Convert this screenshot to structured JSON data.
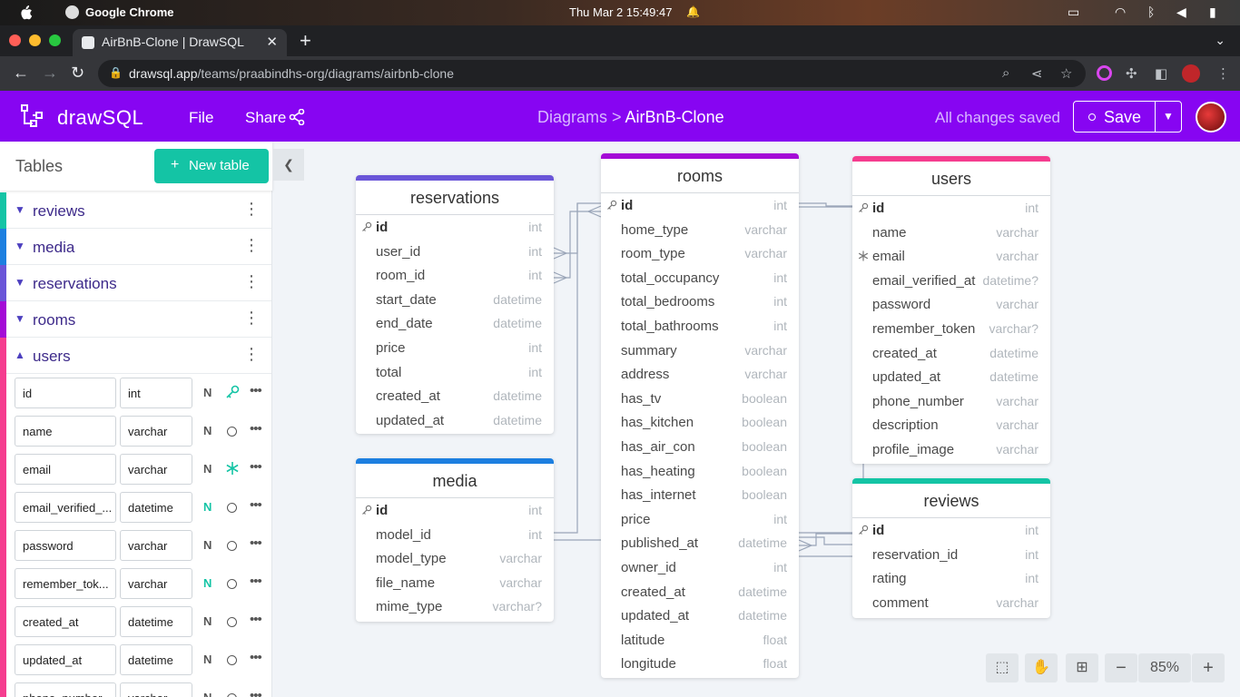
{
  "os": {
    "app_name": "Google Chrome",
    "clock": "Thu Mar 2  15:49:47"
  },
  "browser": {
    "tab_title": "AirBnB-Clone | DrawSQL",
    "url_host": "drawsql.app",
    "url_path": "/teams/praabindhs-org/diagrams/airbnb-clone"
  },
  "header": {
    "logo": "drawSQL",
    "menu_file": "File",
    "menu_share": "Share",
    "breadcrumb_parent": "Diagrams >",
    "breadcrumb_current": "AirBnB-Clone",
    "saved_status": "All changes saved",
    "save_label": "Save"
  },
  "sidebar": {
    "title": "Tables",
    "new_table": "New table",
    "tables": [
      {
        "name": "reviews",
        "color": "#14c4a5"
      },
      {
        "name": "media",
        "color": "#1d7fe0"
      },
      {
        "name": "reservations",
        "color": "#6a55d8"
      },
      {
        "name": "rooms",
        "color": "#a40bd6"
      },
      {
        "name": "users",
        "color": "#f53d8f"
      }
    ],
    "columns": [
      {
        "name": "id",
        "type": "int",
        "null": "N"
      },
      {
        "name": "name",
        "type": "varchar",
        "null": "N"
      },
      {
        "name": "email",
        "type": "varchar",
        "null": "N"
      },
      {
        "name": "email_verified_...",
        "type": "datetime",
        "null": "N"
      },
      {
        "name": "password",
        "type": "varchar",
        "null": "N"
      },
      {
        "name": "remember_tok...",
        "type": "varchar",
        "null": "N"
      },
      {
        "name": "created_at",
        "type": "datetime",
        "null": "N"
      },
      {
        "name": "updated_at",
        "type": "datetime",
        "null": "N"
      },
      {
        "name": "phone_number",
        "type": "varchar",
        "null": "N"
      }
    ]
  },
  "diagram": {
    "reservations": {
      "title": "reservations",
      "color": "#6a55d8",
      "fields": [
        {
          "name": "id",
          "type": "int"
        },
        {
          "name": "user_id",
          "type": "int"
        },
        {
          "name": "room_id",
          "type": "int"
        },
        {
          "name": "start_date",
          "type": "datetime"
        },
        {
          "name": "end_date",
          "type": "datetime"
        },
        {
          "name": "price",
          "type": "int"
        },
        {
          "name": "total",
          "type": "int"
        },
        {
          "name": "created_at",
          "type": "datetime"
        },
        {
          "name": "updated_at",
          "type": "datetime"
        }
      ]
    },
    "media": {
      "title": "media",
      "color": "#1d7fe0",
      "fields": [
        {
          "name": "id",
          "type": "int"
        },
        {
          "name": "model_id",
          "type": "int"
        },
        {
          "name": "model_type",
          "type": "varchar"
        },
        {
          "name": "file_name",
          "type": "varchar"
        },
        {
          "name": "mime_type",
          "type": "varchar?"
        }
      ]
    },
    "rooms": {
      "title": "rooms",
      "color": "#a40bd6",
      "fields": [
        {
          "name": "id",
          "type": "int"
        },
        {
          "name": "home_type",
          "type": "varchar"
        },
        {
          "name": "room_type",
          "type": "varchar"
        },
        {
          "name": "total_occupancy",
          "type": "int"
        },
        {
          "name": "total_bedrooms",
          "type": "int"
        },
        {
          "name": "total_bathrooms",
          "type": "int"
        },
        {
          "name": "summary",
          "type": "varchar"
        },
        {
          "name": "address",
          "type": "varchar"
        },
        {
          "name": "has_tv",
          "type": "boolean"
        },
        {
          "name": "has_kitchen",
          "type": "boolean"
        },
        {
          "name": "has_air_con",
          "type": "boolean"
        },
        {
          "name": "has_heating",
          "type": "boolean"
        },
        {
          "name": "has_internet",
          "type": "boolean"
        },
        {
          "name": "price",
          "type": "int"
        },
        {
          "name": "published_at",
          "type": "datetime"
        },
        {
          "name": "owner_id",
          "type": "int"
        },
        {
          "name": "created_at",
          "type": "datetime"
        },
        {
          "name": "updated_at",
          "type": "datetime"
        },
        {
          "name": "latitude",
          "type": "float"
        },
        {
          "name": "longitude",
          "type": "float"
        }
      ]
    },
    "users": {
      "title": "users",
      "color": "#f53d8f",
      "fields": [
        {
          "name": "id",
          "type": "int"
        },
        {
          "name": "name",
          "type": "varchar"
        },
        {
          "name": "email",
          "type": "varchar"
        },
        {
          "name": "email_verified_at",
          "type": "datetime?"
        },
        {
          "name": "password",
          "type": "varchar"
        },
        {
          "name": "remember_token",
          "type": "varchar?"
        },
        {
          "name": "created_at",
          "type": "datetime"
        },
        {
          "name": "updated_at",
          "type": "datetime"
        },
        {
          "name": "phone_number",
          "type": "varchar"
        },
        {
          "name": "description",
          "type": "varchar"
        },
        {
          "name": "profile_image",
          "type": "varchar"
        }
      ]
    },
    "reviews": {
      "title": "reviews",
      "color": "#14c4a5",
      "fields": [
        {
          "name": "id",
          "type": "int"
        },
        {
          "name": "reservation_id",
          "type": "int"
        },
        {
          "name": "rating",
          "type": "int"
        },
        {
          "name": "comment",
          "type": "varchar"
        }
      ]
    }
  },
  "zoom": {
    "level": "85%",
    "minus": "−",
    "plus": "+"
  }
}
